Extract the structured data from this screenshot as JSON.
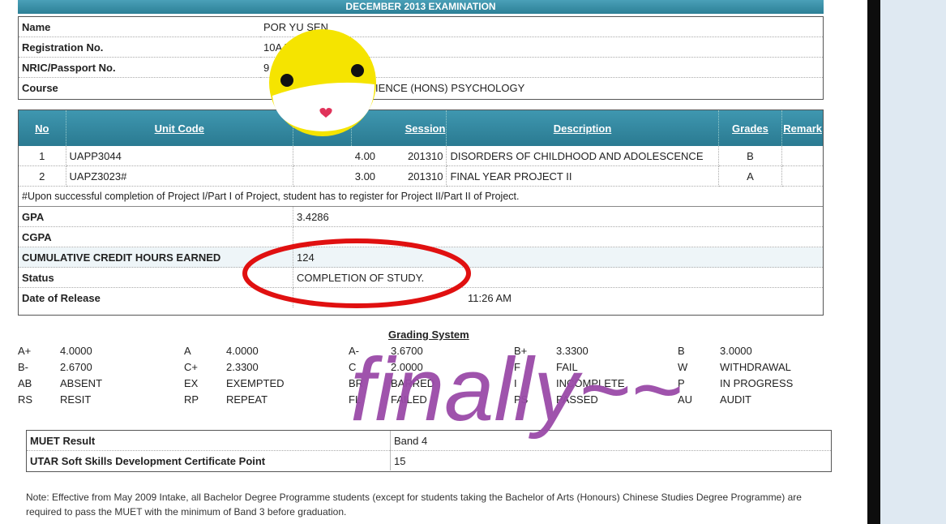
{
  "header": {
    "title": "DECEMBER 2013 EXAMINATION"
  },
  "student": [
    {
      "label": "Name",
      "value": "POR YU SEN"
    },
    {
      "label": "Registration No.",
      "value": "10AA"
    },
    {
      "label": "NRIC/Passport No.",
      "value": "9"
    },
    {
      "label": "Course",
      "value": "SCIENCE (HONS) PSYCHOLOGY"
    }
  ],
  "units": {
    "headers": [
      "No",
      "Unit Code",
      "Session",
      "Description",
      "Grades",
      "Remark"
    ],
    "rows": [
      {
        "no": "1",
        "code": "UAPP3044",
        "credit": "4.00",
        "session": "201310",
        "desc": "DISORDERS OF CHILDHOOD AND ADOLESCENCE",
        "grade": "B",
        "remark": ""
      },
      {
        "no": "2",
        "code": "UAPZ3023#",
        "credit": "3.00",
        "session": "201310",
        "desc": "FINAL YEAR PROJECT II",
        "grade": "A",
        "remark": ""
      }
    ],
    "footnote": "#Upon successful completion of Project I/Part I of Project, student has to register for Project II/Part II of Project."
  },
  "summary": [
    {
      "label": "GPA",
      "value": "3.4286"
    },
    {
      "label": "CGPA",
      "value": ""
    },
    {
      "label": "CUMULATIVE CREDIT HOURS EARNED",
      "value": "124"
    },
    {
      "label": "Status",
      "value": "COMPLETION OF STUDY."
    },
    {
      "label": "Date of Release",
      "value": "11:26 AM"
    }
  ],
  "grading": {
    "title": "Grading System",
    "rows": [
      [
        [
          "A+",
          "4.0000"
        ],
        [
          "A",
          "4.0000"
        ],
        [
          "A-",
          "3.6700"
        ],
        [
          "B+",
          "3.3300"
        ],
        [
          "B",
          "3.0000"
        ]
      ],
      [
        [
          "B-",
          "2.6700"
        ],
        [
          "C+",
          "2.3300"
        ],
        [
          "C",
          "2.0000"
        ],
        [
          "F",
          "FAIL"
        ],
        [
          "W",
          "WITHDRAWAL"
        ]
      ],
      [
        [
          "AB",
          "ABSENT"
        ],
        [
          "EX",
          "EXEMPTED"
        ],
        [
          "BR",
          "BARRED"
        ],
        [
          "I",
          "INCOMPLETE"
        ],
        [
          "P",
          "IN PROGRESS"
        ]
      ],
      [
        [
          "RS",
          "RESIT"
        ],
        [
          "RP",
          "REPEAT"
        ],
        [
          "FL",
          "FAILED"
        ],
        [
          "PS",
          "PASSED"
        ],
        [
          "AU",
          "AUDIT"
        ]
      ]
    ]
  },
  "muet": [
    {
      "label": "MUET Result",
      "value": "Band 4"
    },
    {
      "label": "UTAR Soft Skills Development Certificate Point",
      "value": "15"
    }
  ],
  "note": "Note: Effective from May 2009 Intake, all Bachelor Degree Programme students (except for students taking the Bachelor of Arts (Honours) Chinese Studies Degree Programme) are required to pass the MUET with the minimum of Band 3 before graduation.",
  "annotation": {
    "handwriting": "finally~~"
  },
  "colors": {
    "header_teal": "#2c7f96",
    "circle_red": "#e01010",
    "marker_purple": "#9a4aa8",
    "sticker_yellow": "#f5e400"
  }
}
